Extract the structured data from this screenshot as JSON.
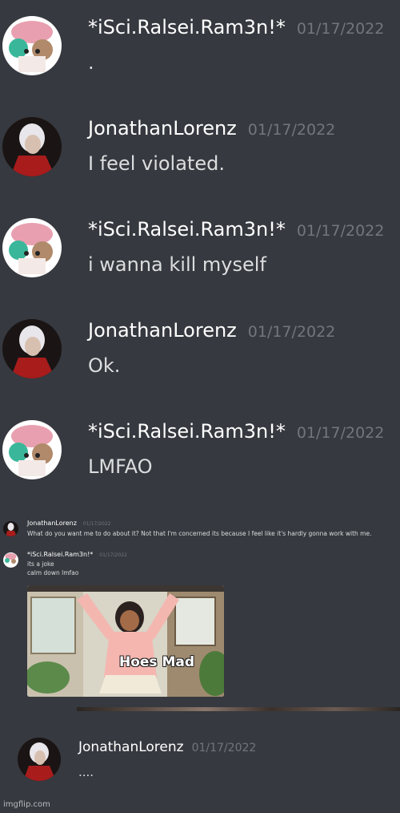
{
  "messages_large": [
    {
      "author": "*iSci.Ralsei.Ram3n!*",
      "date": "01/17/2022",
      "text": ".",
      "avatar": "ralsei-cake-avatar"
    },
    {
      "author": "JonathanLorenz",
      "date": "01/17/2022",
      "text": "I feel violated.",
      "avatar": "red-coat-character-avatar"
    },
    {
      "author": "*iSci.Ralsei.Ram3n!*",
      "date": "01/17/2022",
      "text": "i wanna kill myself",
      "avatar": "ralsei-cake-avatar"
    },
    {
      "author": "JonathanLorenz",
      "date": "01/17/2022",
      "text": "Ok.",
      "avatar": "red-coat-character-avatar"
    },
    {
      "author": "*iSci.Ralsei.Ram3n!*",
      "date": "01/17/2022",
      "text": "LMFAO",
      "avatar": "ralsei-cake-avatar"
    }
  ],
  "messages_small": [
    {
      "author": "JonathanLorenz",
      "date": "01/17/2022",
      "lines": [
        "What do you want me to do about it? Not that I'm concerned its because I feel like it's hardly gonna work with me."
      ]
    },
    {
      "author": "*iSci.Ralsei.Ram3n!*",
      "date": "01/17/2022",
      "lines": [
        "its a joke",
        "calm down lmfao"
      ]
    }
  ],
  "gif": {
    "caption": "Hoes Mad",
    "description": "anime-girl-gif"
  },
  "final_message": {
    "author": "JonathanLorenz",
    "date": "01/17/2022",
    "text": "...."
  },
  "watermark": "imgflip.com",
  "colors": {
    "background": "#36393f",
    "name": "#ffffff",
    "date": "#72767d",
    "text": "#dcddde"
  }
}
